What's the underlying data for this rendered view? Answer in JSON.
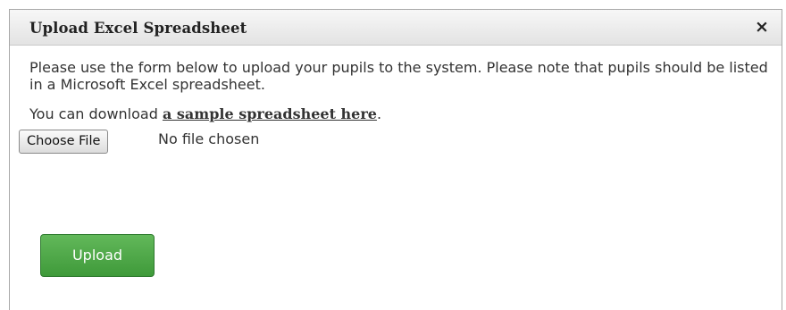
{
  "dialog": {
    "title": "Upload Excel Spreadsheet",
    "close_icon": "×",
    "intro": "Please use the form below to upload your pupils to the system. Please note that pupils should be listed in a Microsoft Excel spreadsheet.",
    "download_prefix": "You can download ",
    "download_link": "a sample spreadsheet here",
    "download_suffix": "."
  },
  "file_input": {
    "button_label": "Choose File",
    "status": "No file chosen"
  },
  "actions": {
    "upload_label": "Upload",
    "upload_color": "#4fa94a"
  },
  "icons": {
    "close": "close-icon"
  }
}
